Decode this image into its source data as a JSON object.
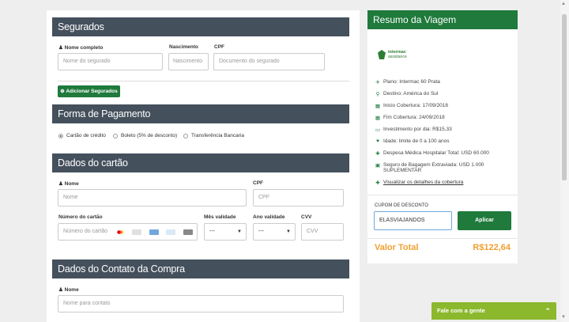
{
  "insured": {
    "title": "Segurados",
    "name_label": "Nome completo",
    "name_placeholder": "Nome do segurado",
    "birth_label": "Nascimento",
    "birth_placeholder": "Nascimento",
    "cpf_label": "CPF",
    "cpf_placeholder": "Documento do segurado",
    "add_button": "Adicionar Segurados"
  },
  "payment": {
    "title": "Forma de Pagamento",
    "options": [
      "Cartão de crédito",
      "Boleto (5% de desconto)",
      "Transferência Bancaria"
    ],
    "selected": "Cartão de crédito"
  },
  "card": {
    "title": "Dados do cartão",
    "name_label": "Nome",
    "name_placeholder": "Nome",
    "cpf_label": "CPF",
    "cpf_placeholder": "CPF",
    "number_label": "Número do cartão",
    "number_placeholder": "Número do cartão",
    "month_label": "Mês validade",
    "month_value": "---",
    "year_label": "Ano validade",
    "year_value": "---",
    "cvv_label": "CVV",
    "cvv_placeholder": "CVV",
    "brand_colors": [
      "#eb001b",
      "#cccccc",
      "#6fa8dc",
      "#9fc5e8",
      "#888888"
    ]
  },
  "contact": {
    "title": "Dados do Contato da Compra",
    "name_label": "Nome",
    "name_placeholder": "Nome para contato"
  },
  "summary": {
    "title": "Resumo da Viagem",
    "logo_line1": "intermac",
    "logo_line2": "assistance",
    "items": [
      {
        "icon": "plane-icon",
        "glyph": "✈",
        "text": "Plano: Intermac 60 Prata"
      },
      {
        "icon": "location-icon",
        "glyph": "⚲",
        "text": "Destino: América do Sul"
      },
      {
        "icon": "calendar-icon",
        "glyph": "▦",
        "text": "Inicio Cobertura: 17/09/2018"
      },
      {
        "icon": "calendar-icon",
        "glyph": "▦",
        "text": "Fim Cobertura: 24/09/2018"
      },
      {
        "icon": "money-icon",
        "glyph": "▭",
        "text": "Investimento por dia: R$15,33"
      },
      {
        "icon": "heart-icon",
        "glyph": "♥",
        "text": "Idade: limite de 0 a 100 anos"
      },
      {
        "icon": "medical-icon",
        "glyph": "✚",
        "text": "Despesa Médica Hospitalar Total: USD 60.000"
      },
      {
        "icon": "suitcase-icon",
        "glyph": "▣",
        "text": "Seguro de Bagagem Extraviada: USD 1.000 SUPLEMENTAR"
      }
    ],
    "details_link": "Visualizar os detalhes da cobertura",
    "coupon_label": "CUPOM DE DESCONTO",
    "coupon_value": "ELASVIAJANDOS",
    "apply_button": "Aplicar",
    "total_label": "Valor Total",
    "total_value": "R$122,64"
  },
  "chat": {
    "label": "Fale com a gente"
  },
  "colors": {
    "header_dark": "#44505c",
    "brand_green": "#1f7a3c",
    "total_orange": "#f0a030",
    "chat_green": "#8bb82d"
  }
}
